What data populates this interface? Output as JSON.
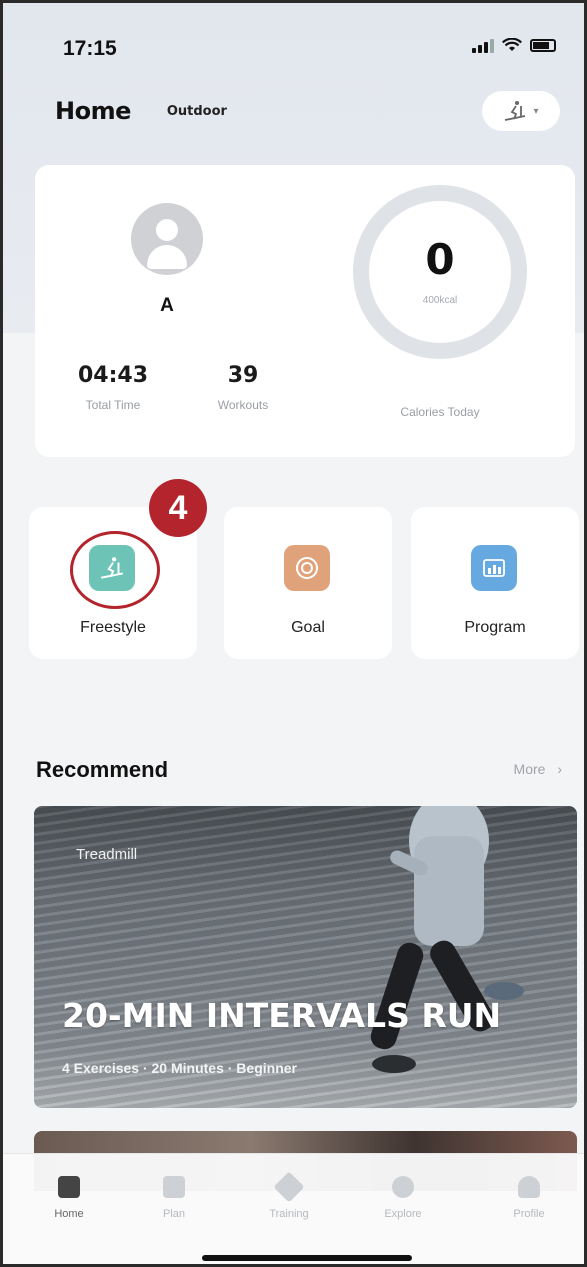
{
  "status_bar": {
    "time": "17:15"
  },
  "header": {
    "title": "Home",
    "tab_outdoor": "Outdoor"
  },
  "profile": {
    "name": "A"
  },
  "stats": {
    "total_time_value": "04:43",
    "total_time_label": "Total Time",
    "workouts_value": "39",
    "workouts_label": "Workouts"
  },
  "calories": {
    "value": "0",
    "unit": "400kcal",
    "label": "Calories Today"
  },
  "modes": [
    {
      "label": "Freestyle",
      "icon": "treadmill-icon",
      "color": "#6cc3b6"
    },
    {
      "label": "Goal",
      "icon": "target-icon",
      "color": "#e0a27a"
    },
    {
      "label": "Program",
      "icon": "chart-icon",
      "color": "#66a9e0"
    }
  ],
  "annotation": {
    "step": "4",
    "color": "#b3242c"
  },
  "recommend": {
    "title": "Recommend",
    "more": "More",
    "card": {
      "tag": "Treadmill",
      "title": "20-MIN INTERVALS RUN",
      "subtitle": "4 Exercises · 20 Minutes · Beginner"
    }
  },
  "tabbar": [
    {
      "label": "Home",
      "icon": "home-icon",
      "active": true
    },
    {
      "label": "Plan",
      "icon": "calendar-icon"
    },
    {
      "label": "Training",
      "icon": "layers-icon"
    },
    {
      "label": "Explore",
      "icon": "compass-icon"
    },
    {
      "label": "Profile",
      "icon": "person-icon"
    }
  ]
}
